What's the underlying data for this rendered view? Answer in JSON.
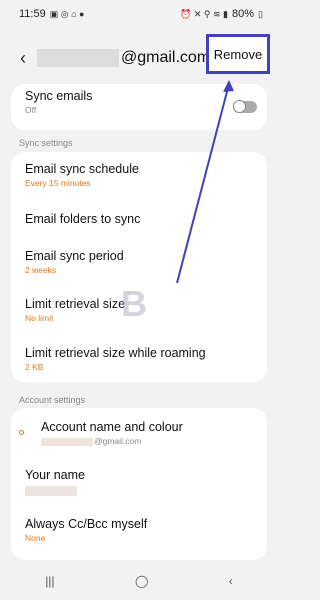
{
  "statusbar": {
    "time": "11:59",
    "battery": "80%"
  },
  "header": {
    "email_suffix": "@gmail.com",
    "remove_label": "Remove"
  },
  "sync_emails": {
    "title": "Sync emails",
    "sub": "Off"
  },
  "sections": {
    "sync_settings": "Sync settings",
    "account_settings": "Account settings"
  },
  "sync": [
    {
      "title": "Email sync schedule",
      "sub": "Every 15 minutes"
    },
    {
      "title": "Email folders to sync",
      "sub": ""
    },
    {
      "title": "Email sync period",
      "sub": "2 weeks"
    },
    {
      "title": "Limit retrieval size",
      "sub": "No limit"
    },
    {
      "title": "Limit retrieval size while roaming",
      "sub": "2 KB"
    }
  ],
  "account": [
    {
      "title": "Account name and colour",
      "sub": "@gmail.com"
    },
    {
      "title": "Your name",
      "sub": ""
    },
    {
      "title": "Always Cc/Bcc myself",
      "sub": "None"
    }
  ],
  "navbar": {
    "recent": "|||",
    "home": "◯",
    "back": "‹"
  },
  "colors": {
    "accent": "#e07a1e",
    "highlight_border": "#4242b8"
  }
}
